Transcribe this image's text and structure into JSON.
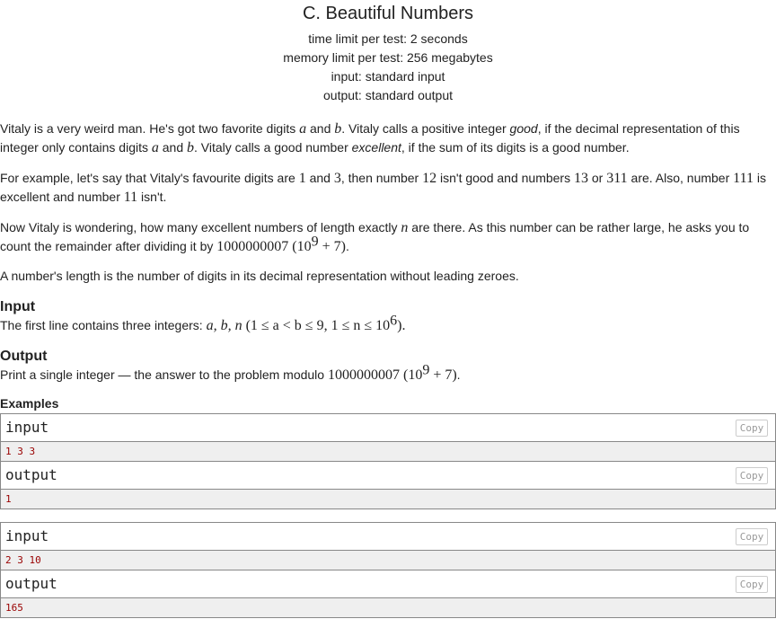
{
  "problem": {
    "title": "C. Beautiful Numbers",
    "time_limit": "time limit per test: 2 seconds",
    "memory_limit": "memory limit per test: 256 megabytes",
    "input_type": "input: standard input",
    "output_type": "output: standard output"
  },
  "statement": {
    "p1": {
      "t1": "Vitaly is a very weird man. He's got two favorite digits ",
      "a": "a",
      "t2": " and ",
      "b": "b",
      "t3": ". Vitaly calls a positive integer ",
      "good": "good",
      "t4": ", if the decimal representation of this integer only contains digits ",
      "a2": "a",
      "t5": " and ",
      "b2": "b",
      "t6": ". Vitaly calls a good number ",
      "excellent": "excellent",
      "t7": ", if the sum of its digits is a good number."
    },
    "p2": {
      "t1": "For example, let's say that Vitaly's favourite digits are ",
      "n1": "1",
      "t2": " and ",
      "n3": "3",
      "t3": ", then number ",
      "n12": "12",
      "t4": " isn't good and numbers ",
      "n13": "13",
      "t5": " or ",
      "n311": "311",
      "t6": " are. Also, number ",
      "n111": "111",
      "t7": " is excellent and number ",
      "n11": "11",
      "t8": " isn't."
    },
    "p3": {
      "t1": "Now Vitaly is wondering, how many excellent numbers of length exactly ",
      "n": "n",
      "t2": " are there. As this number can be rather large, he asks you to count the remainder after dividing it by ",
      "mod": "1000000007 (10",
      "exp": "9",
      "mod_tail": " + 7)",
      "t3": "."
    },
    "p4": "A number's length is the number of digits in its decimal representation without leading zeroes."
  },
  "input_section": {
    "title": "Input",
    "text": "The first line contains three integers: ",
    "vars": "a, b, n",
    "constraint_a": " (1 ≤ a < b ≤ 9, 1 ≤ n ≤ 10",
    "constraint_exp": "6",
    "constraint_tail": ")."
  },
  "output_section": {
    "title": "Output",
    "text": "Print a single integer — the answer to the problem modulo ",
    "mod": "1000000007 (10",
    "exp": "9",
    "mod_tail": " + 7)",
    "end": "."
  },
  "examples": {
    "title": "Examples",
    "copy_label": "Copy",
    "input_label": "input",
    "output_label": "output",
    "items": [
      {
        "input": "1 3 3",
        "output": "1"
      },
      {
        "input": "2 3 10",
        "output": "165"
      }
    ]
  }
}
